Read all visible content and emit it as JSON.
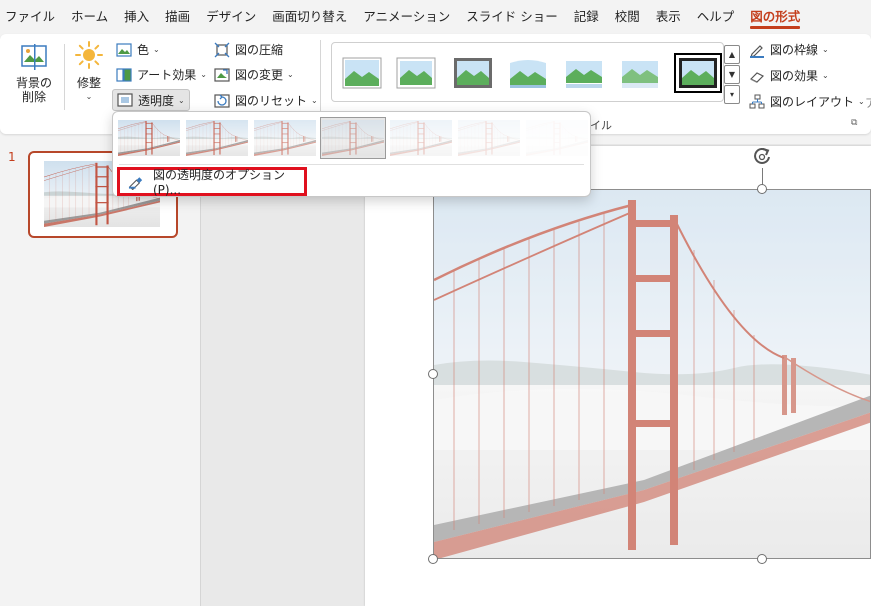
{
  "menu": {
    "tabs": [
      "ファイル",
      "ホーム",
      "挿入",
      "描画",
      "デザイン",
      "画面切り替え",
      "アニメーション",
      "スライド ショー",
      "記録",
      "校閲",
      "表示",
      "ヘルプ",
      "図の形式"
    ],
    "active_tab": "図の形式"
  },
  "ribbon": {
    "remove_bg_line1": "背景の",
    "remove_bg_line2": "削除",
    "corrections": "修整",
    "color": "色",
    "artistic_effects": "アート効果",
    "transparency": "透明度",
    "compress": "図の圧縮",
    "change_picture": "図の変更",
    "reset_picture": "図のリセット",
    "styles_group_label": "イル",
    "border": "図の枠線",
    "effects": "図の効果",
    "layout": "図のレイアウト",
    "side_label": "ア"
  },
  "dropdown": {
    "presets": [
      {
        "transparency": 0
      },
      {
        "transparency": 0.15
      },
      {
        "transparency": 0.3
      },
      {
        "transparency": 0.5
      },
      {
        "transparency": 0.65
      },
      {
        "transparency": 0.8
      },
      {
        "transparency": 0.95
      }
    ],
    "selected_index": 3,
    "options_label": "図の透明度のオプション(P)..."
  },
  "slides_panel": {
    "slide_number": "1"
  },
  "colors": {
    "accent": "#c43e1c",
    "highlight": "#e0101e"
  }
}
